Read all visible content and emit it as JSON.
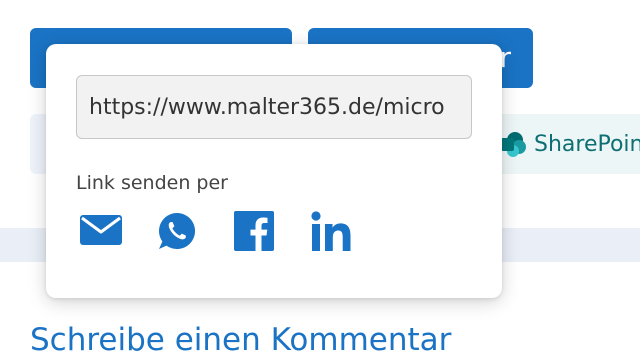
{
  "background": {
    "button_right_label": "r",
    "sharepoint_label": "SharePoint",
    "comment_heading": "Schreibe einen Kommentar"
  },
  "share_popover": {
    "url_value": "https://www.malter365.de/micro",
    "send_label": "Link senden per",
    "icons": [
      "email-icon",
      "whatsapp-icon",
      "facebook-icon",
      "linkedin-icon"
    ]
  },
  "colors": {
    "accent_blue": "#1a73c4",
    "sharepoint_teal": "#0e6f73"
  }
}
